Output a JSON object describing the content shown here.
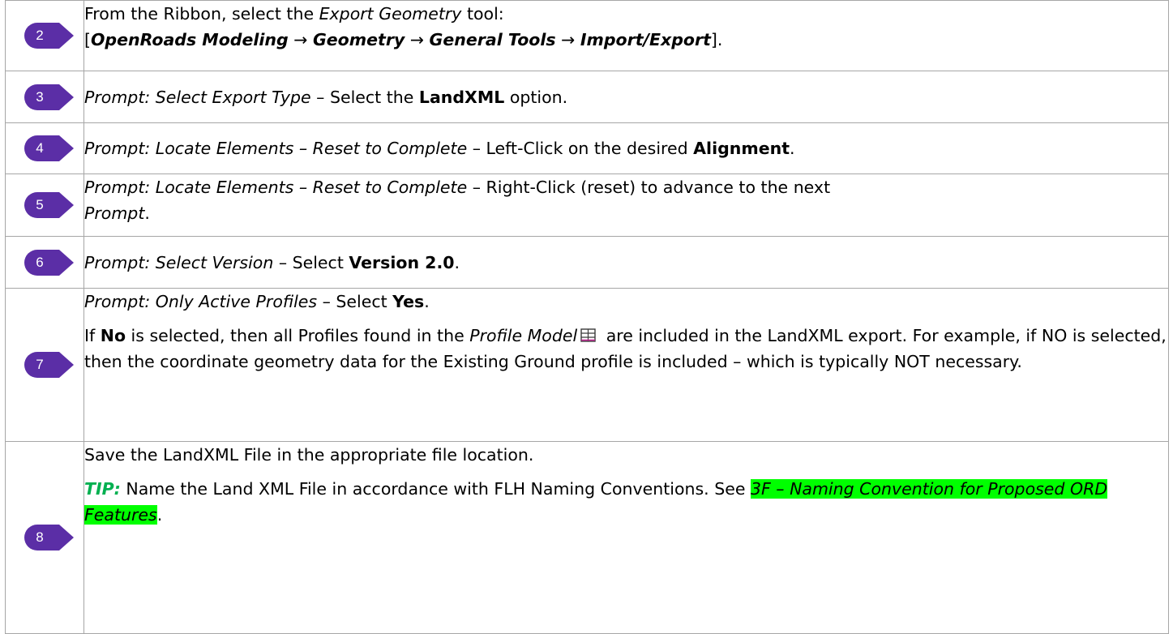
{
  "colors": {
    "badge": "#5b2ea6",
    "tip": "#00b050",
    "highlight": "#00ff00",
    "border": "#a6a6a6"
  },
  "steps": [
    {
      "number": "2",
      "line1": "From the Ribbon, select the ",
      "tool": "Export Geometry",
      "line1_end": " tool:",
      "path": {
        "open": "[",
        "p1": "OpenRoads Modeling",
        "arrow": "→",
        "p2": "Geometry",
        "p3": "General Tools",
        "p4": "Import/Export",
        "close": "]."
      }
    },
    {
      "number": "3",
      "prompt": "Prompt:  Select Export Type",
      "dash": " – ",
      "text": "Select the ",
      "bold": "LandXML",
      "end": " option."
    },
    {
      "number": "4",
      "prompt": "Prompt:  Locate Elements",
      "dash_inner": " – ",
      "prompt2": "Reset to Complete",
      "dash": " – ",
      "text": "Left-Click on the desired ",
      "bold": "Alignment",
      "end": "."
    },
    {
      "number": "5",
      "prompt": "Prompt:  Locate Elements",
      "dash_inner": " – ",
      "prompt2": "Reset to Complete",
      "dash": " – ",
      "text": "Right-Click (reset) to advance to the next",
      "italic_end": "Prompt",
      "end": "."
    },
    {
      "number": "6",
      "prompt": "Prompt:  Select Version",
      "dash": " – ",
      "text": "Select ",
      "bold": "Version 2.0",
      "end": "."
    },
    {
      "number": "7",
      "prompt": "Prompt:  Only Active Profiles",
      "dash": " – ",
      "text": "Select ",
      "bold": "Yes",
      "end": ".",
      "para": {
        "a": "If ",
        "b": "No",
        "c": " is selected, then all Profiles found in the ",
        "d": "Profile Model",
        "e": " are included in the LandXML export.  For example, if NO is selected, then the coordinate geometry data for the Existing Ground profile is included – which is typically NOT necessary."
      }
    },
    {
      "number": "8",
      "line1": "Save the LandXML File in the appropriate file location.",
      "tip_label": "TIP:",
      "tip_text": "  Name the Land XML File in accordance with FLH Naming Conventions.  See ",
      "link": "3F – Naming Convention for Proposed ORD Features",
      "end": "."
    }
  ]
}
